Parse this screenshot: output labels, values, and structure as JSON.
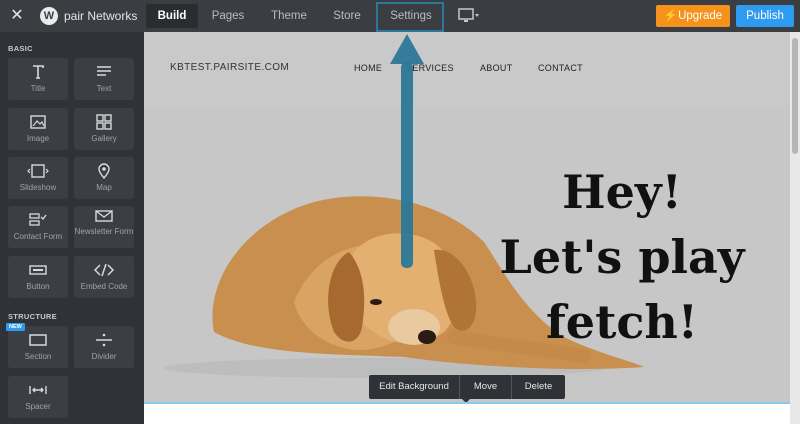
{
  "topbar": {
    "brand": "pair Networks",
    "tabs": [
      {
        "label": "Build",
        "active": true
      },
      {
        "label": "Pages",
        "active": false
      },
      {
        "label": "Theme",
        "active": false
      },
      {
        "label": "Store",
        "active": false
      },
      {
        "label": "Settings",
        "active": false
      }
    ],
    "upgrade_label": "Upgrade",
    "publish_label": "Publish"
  },
  "sidebar": {
    "basic_label": "BASIC",
    "structure_label": "STRUCTURE",
    "new_badge": "NEW",
    "basic_items": [
      {
        "label": "Title",
        "icon": "title-icon"
      },
      {
        "label": "Text",
        "icon": "text-icon"
      },
      {
        "label": "Image",
        "icon": "image-icon"
      },
      {
        "label": "Gallery",
        "icon": "gallery-icon"
      },
      {
        "label": "Slideshow",
        "icon": "slideshow-icon"
      },
      {
        "label": "Map",
        "icon": "map-pin-icon"
      },
      {
        "label": "Contact Form",
        "icon": "contact-form-icon"
      },
      {
        "label": "Newsletter Form",
        "icon": "newsletter-icon"
      },
      {
        "label": "Button",
        "icon": "button-icon"
      },
      {
        "label": "Embed Code",
        "icon": "embed-code-icon"
      }
    ],
    "structure_items": [
      {
        "label": "Section",
        "icon": "section-icon"
      },
      {
        "label": "Divider",
        "icon": "divider-icon"
      },
      {
        "label": "Spacer",
        "icon": "spacer-icon"
      }
    ]
  },
  "site": {
    "title": "KBTEST.PAIRSITE.COM",
    "nav": [
      "HOME",
      "SERVICES",
      "ABOUT",
      "CONTACT"
    ],
    "hero_lines": [
      "Hey!",
      "Let's play",
      "fetch!"
    ]
  },
  "edit_bar": {
    "edit_background": "Edit Background",
    "move": "Move",
    "delete": "Delete"
  },
  "colors": {
    "upgrade": "#f5921c",
    "publish": "#2f9bf0",
    "annotation_arrow": "#2c7898"
  }
}
